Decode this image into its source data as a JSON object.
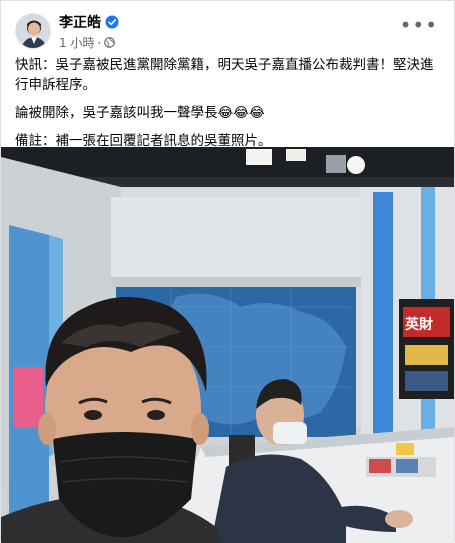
{
  "post": {
    "author": {
      "name": "李正皓",
      "verified": true,
      "avatar_icon": "person-avatar-icon"
    },
    "meta": {
      "time": "1 小時",
      "separator": "·",
      "privacy_icon": "globe-icon"
    },
    "more_icon": "more-horizontal-icon",
    "more_glyph": "•••",
    "paragraphs": [
      "快訊：吳子嘉被民進黨開除黨籍，明天吳子嘉直播公布裁判書！堅決進行申訴程序。",
      "論被開除，吳子嘉該叫我一聲學長😂😂😂",
      "備註：補一張在回覆記者訊息的吳董照片。"
    ],
    "photo": {
      "alt": "two men in a TV news studio",
      "poster_text": "英財",
      "colors": {
        "studio_wall": "#d9dde0",
        "screen": "#2e6aa8",
        "accent_blue": "#3b7fd4"
      }
    }
  },
  "colors": {
    "accent": "#1877f2",
    "meta": "#65676b",
    "text": "#050505"
  }
}
